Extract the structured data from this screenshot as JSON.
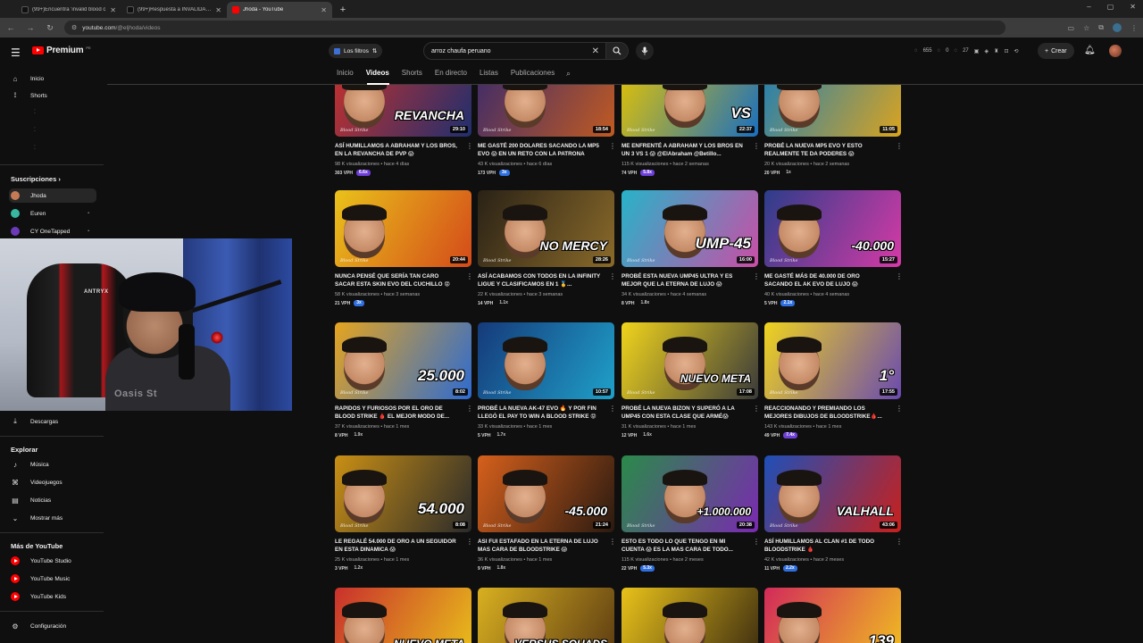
{
  "browser": {
    "tabs": [
      {
        "label": "(99+)Encuentra 'invalid blood c",
        "icon": "tiktok-icon",
        "active": false
      },
      {
        "label": "(99+)Respuesta a INVALIDAD !",
        "icon": "tiktok-icon",
        "active": false
      },
      {
        "label": "Jhoda - YouTube",
        "icon": "youtube-icon",
        "active": true
      }
    ],
    "new_tab": "+",
    "url_host": "youtube.com",
    "url_path": "/@eljhoda/videos",
    "window_controls": [
      "–",
      "▢",
      "✕"
    ]
  },
  "masthead": {
    "brand": "Premium",
    "country": "PE",
    "filter_label": "Los filtros",
    "search_value": "arroz chaufa peruano",
    "ext_counts": [
      "655",
      "0",
      "27"
    ],
    "create_label": "Crear"
  },
  "channel_tabs": [
    "Inicio",
    "Videos",
    "Shorts",
    "En directo",
    "Listas",
    "Publicaciones"
  ],
  "channel_tabs_active": "Videos",
  "sidebar": {
    "home": "Inicio",
    "shorts": "Shorts",
    "subs_title": "Suscripciones",
    "subs": [
      {
        "name": "Jhoda",
        "color": "#c47a55"
      },
      {
        "name": "Euren",
        "color": "#38b8a0"
      },
      {
        "name": "CY OneTapped",
        "color": "#6a3ab8"
      }
    ],
    "downloads": "Descargas",
    "explore_title": "Explorar",
    "explore": [
      "Música",
      "Videojuegos",
      "Noticias",
      "Mostrar más"
    ],
    "more_title": "Más de YouTube",
    "more": [
      "YouTube Studio",
      "YouTube Music",
      "YouTube Kids"
    ],
    "settings": "Configuración"
  },
  "webcam": {
    "chair_brand": "ANTRYX",
    "shirt_text": "Oasis St"
  },
  "videos": [
    {
      "title": "ASÍ HUMILLAMOS A ABRAHAM Y LOS BROS, EN LA REVANCHA DE PVP 😱",
      "views": "98 K visualizaciones",
      "age": "hace 4 días",
      "vph": "303 VPH",
      "mult": "6.6x",
      "mult_style": "purple",
      "duration": "29:10",
      "overlay": "REVANCHA",
      "bg": "#c9302c",
      "bg2": "#1f2f6e"
    },
    {
      "title": "ME GASTÉ 200 DOLARES SACANDO LA MP5 EVO 😱 EN UN RETO CON LA PATRONA",
      "views": "43 K visualizaciones",
      "age": "hace 6 días",
      "vph": "173 VPH",
      "mult": "3x",
      "mult_style": "blue",
      "duration": "18:54",
      "overlay": "",
      "bg": "#3b2a6b",
      "bg2": "#c05a22"
    },
    {
      "title": "ME ENFRENTÉ A ABRAHAM Y LOS BROS EN UN 3 VS 1 😱 @ElAbraham @Betillo...",
      "views": "115 K visualizaciones",
      "age": "hace 2 semanas",
      "vph": "74 VPH",
      "mult": "5.8x",
      "mult_style": "purple",
      "duration": "22:37",
      "overlay": "VS",
      "bg": "#e6c400",
      "bg2": "#1a6fbf"
    },
    {
      "title": "PROBÉ LA NUEVA MP5 EVO Y ESTO REALMENTE TE DA PODERES 😱",
      "views": "20 K visualizaciones",
      "age": "hace 2 semanas",
      "vph": "20 VPH",
      "mult": "1x",
      "mult_style": "plain",
      "duration": "11:05",
      "overlay": "",
      "bg": "#1d7fb6",
      "bg2": "#d9a320"
    },
    {
      "title": "NUNCA PENSÉ QUE SERÍA TAN CARO SACAR ESTA SKIN EVO DEL CUCHILLO 😡",
      "views": "58 K visualizaciones",
      "age": "hace 3 semanas",
      "vph": "21 VPH",
      "mult": "3x",
      "mult_style": "blue",
      "duration": "20:44",
      "overlay": "",
      "bg": "#e9c21a",
      "bg2": "#d44a1a"
    },
    {
      "title": "ASÍ ACABAMOS CON TODOS EN LA INFINITY LIGUE Y CLASIFICAMOS EN 1 🥇...",
      "views": "22 K visualizaciones",
      "age": "hace 3 semanas",
      "vph": "14 VPH",
      "mult": "1.1x",
      "mult_style": "plain",
      "duration": "28:26",
      "overlay": "NO MERCY",
      "bg": "#2a2216",
      "bg2": "#8a6a2a"
    },
    {
      "title": "PROBÉ ESTA NUEVA UMP45 ULTRA Y ES MEJOR QUE LA ETERNA DE LUJO 😱",
      "views": "34 K visualizaciones",
      "age": "hace 4 semanas",
      "vph": "8 VPH",
      "mult": "1.8x",
      "mult_style": "plain",
      "duration": "16:00",
      "overlay": "UMP-45",
      "bg": "#27b3c9",
      "bg2": "#c94ea6"
    },
    {
      "title": "ME GASTÉ MÁS DE 40.000 DE ORO SACANDO EL AK EVO DE LUJO 😱",
      "views": "40 K visualizaciones",
      "age": "hace 4 semanas",
      "vph": "5 VPH",
      "mult": "2.1x",
      "mult_style": "blue",
      "duration": "15:27",
      "overlay": "-40.000",
      "bg": "#2c3d8a",
      "bg2": "#d63aa6"
    },
    {
      "title": "RAPIDOS Y FURIOSOS POR EL ORO DE BLOOD STRIKE 🩸 EL MEJOR MODO DE...",
      "views": "37 K visualizaciones",
      "age": "hace 1 mes",
      "vph": "8 VPH",
      "mult": "1.9x",
      "mult_style": "plain",
      "duration": "8:02",
      "overlay": "25.000",
      "bg": "#e5a41f",
      "bg2": "#2d6bd1"
    },
    {
      "title": "PROBÉ LA NUEVA AK-47 EVO 🔥 Y POR FIN LLEGÓ EL PAY TO WIN A BLOOD STRIKE 😡",
      "views": "33 K visualizaciones",
      "age": "hace 1 mes",
      "vph": "5 VPH",
      "mult": "1.7x",
      "mult_style": "plain",
      "duration": "10:57",
      "overlay": "",
      "bg": "#153a7a",
      "bg2": "#1fa0c9"
    },
    {
      "title": "PROBÉ LA NUEVA BIZON Y SUPERÓ A LA UMP45 CON ESTA CLASE QUE ARMÉ😱",
      "views": "31 K visualizaciones",
      "age": "hace 1 mes",
      "vph": "12 VPH",
      "mult": "1.6x",
      "mult_style": "plain",
      "duration": "17:08",
      "overlay": "NUEVO META",
      "bg": "#f0d41c",
      "bg2": "#3a3a3a"
    },
    {
      "title": "REACCIONANDO Y PREMIANDO LOS MEJORES DIBUJOS DE BLOODSTRIKE🩸...",
      "views": "143 K visualizaciones",
      "age": "hace 1 mes",
      "vph": "49 VPH",
      "mult": "7.4x",
      "mult_style": "purple",
      "duration": "17:55",
      "overlay": "1°",
      "bg": "#efd31e",
      "bg2": "#6a4ab0"
    },
    {
      "title": "LE REGALÉ 54.000 DE ORO A UN SEGUIDOR EN ESTA DINAMICA 😱",
      "views": "25 K visualizaciones",
      "age": "hace 1 mes",
      "vph": "3 VPH",
      "mult": "1.2x",
      "mult_style": "plain",
      "duration": "8:08",
      "overlay": "54.000",
      "bg": "#c98f14",
      "bg2": "#2a2a2a"
    },
    {
      "title": "ASI FUI ESTAFADO EN LA ETERNA DE LUJO MAS CARA DE BLOODSTRIKE 😱",
      "views": "36 K visualizaciones",
      "age": "hace 1 mes",
      "vph": "9 VPH",
      "mult": "1.8x",
      "mult_style": "plain",
      "duration": "21:24",
      "overlay": "-45.000",
      "bg": "#d6601c",
      "bg2": "#2a1a10"
    },
    {
      "title": "ESTO ES TODO LO QUE TENGO EN MI CUENTA 😱 ES LA MAS CARA DE TODO...",
      "views": "115 K visualizaciones",
      "age": "hace 2 meses",
      "vph": "22 VPH",
      "mult": "5.3x",
      "mult_style": "blue",
      "duration": "20:38",
      "overlay": "+1.000.000",
      "bg": "#2a8a4a",
      "bg2": "#7a2ab0"
    },
    {
      "title": "ASÍ HUMILLAMOS AL CLAN #1 DE TODO BLOODSTRIKE 🩸",
      "views": "42 K visualizaciones",
      "age": "hace 2 meses",
      "vph": "11 VPH",
      "mult": "2.2x",
      "mult_style": "blue",
      "duration": "43:06",
      "overlay": "VALHALL",
      "bg": "#1e4fb8",
      "bg2": "#c8201c"
    },
    {
      "title": "",
      "views": "",
      "age": "",
      "vph": "",
      "mult": "",
      "mult_style": "plain",
      "duration": "",
      "overlay": "NUEVO META",
      "bg": "#c9302c",
      "bg2": "#e9c21a"
    },
    {
      "title": "",
      "views": "",
      "age": "",
      "vph": "",
      "mult": "",
      "mult_style": "plain",
      "duration": "",
      "overlay": "VERSUS SQUADS",
      "bg": "#d9b020",
      "bg2": "#5a3a12"
    },
    {
      "title": "",
      "views": "",
      "age": "",
      "vph": "",
      "mult": "",
      "mult_style": "plain",
      "duration": "",
      "overlay": "",
      "bg": "#e9c21a",
      "bg2": "#3a2a10"
    },
    {
      "title": "",
      "views": "",
      "age": "",
      "vph": "",
      "mult": "",
      "mult_style": "plain",
      "duration": "",
      "overlay": "139",
      "bg": "#d22a5a",
      "bg2": "#f0c020"
    }
  ],
  "thumb_signature": "Blood Strike"
}
